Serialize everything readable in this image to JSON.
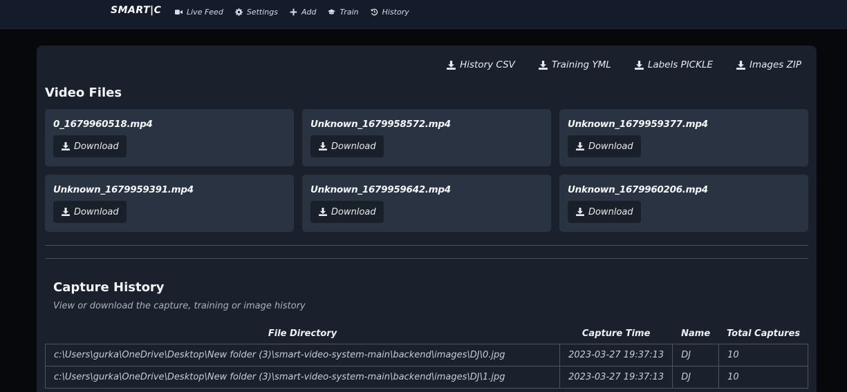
{
  "nav": {
    "brand": "SMART|C",
    "items": [
      {
        "label": "Live Feed",
        "icon": "video-camera-icon"
      },
      {
        "label": "Settings",
        "icon": "gear-icon"
      },
      {
        "label": "Add",
        "icon": "plus-icon"
      },
      {
        "label": "Train",
        "icon": "graduation-cap-icon"
      },
      {
        "label": "History",
        "icon": "history-icon"
      }
    ]
  },
  "exports": [
    {
      "label": "History CSV",
      "icon": "download-icon"
    },
    {
      "label": "Training YML",
      "icon": "download-icon"
    },
    {
      "label": "Labels PICKLE",
      "icon": "download-icon"
    },
    {
      "label": "Images ZIP",
      "icon": "download-icon"
    }
  ],
  "videos": {
    "title": "Video Files",
    "download_label": "Download",
    "files": [
      "0_1679960518.mp4",
      "Unknown_1679958572.mp4",
      "Unknown_1679959377.mp4",
      "Unknown_1679959391.mp4",
      "Unknown_1679959642.mp4",
      "Unknown_1679960206.mp4"
    ]
  },
  "history": {
    "title": "Capture History",
    "subtitle": "View or download the capture, training or image history",
    "columns": [
      "File Directory",
      "Capture Time",
      "Name",
      "Total Captures"
    ],
    "rows": [
      [
        "c:\\Users\\gurka\\OneDrive\\Desktop\\New folder (3)\\smart-video-system-main\\backend\\images\\DJ\\0.jpg",
        "2023-03-27 19:37:13",
        "DJ",
        "10"
      ],
      [
        "c:\\Users\\gurka\\OneDrive\\Desktop\\New folder (3)\\smart-video-system-main\\backend\\images\\DJ\\1.jpg",
        "2023-03-27 19:37:13",
        "DJ",
        "10"
      ]
    ]
  },
  "colors": {
    "navbar": "#141c2b",
    "panel": "#1a212c",
    "card": "#2a3341",
    "button": "#1a2029"
  }
}
